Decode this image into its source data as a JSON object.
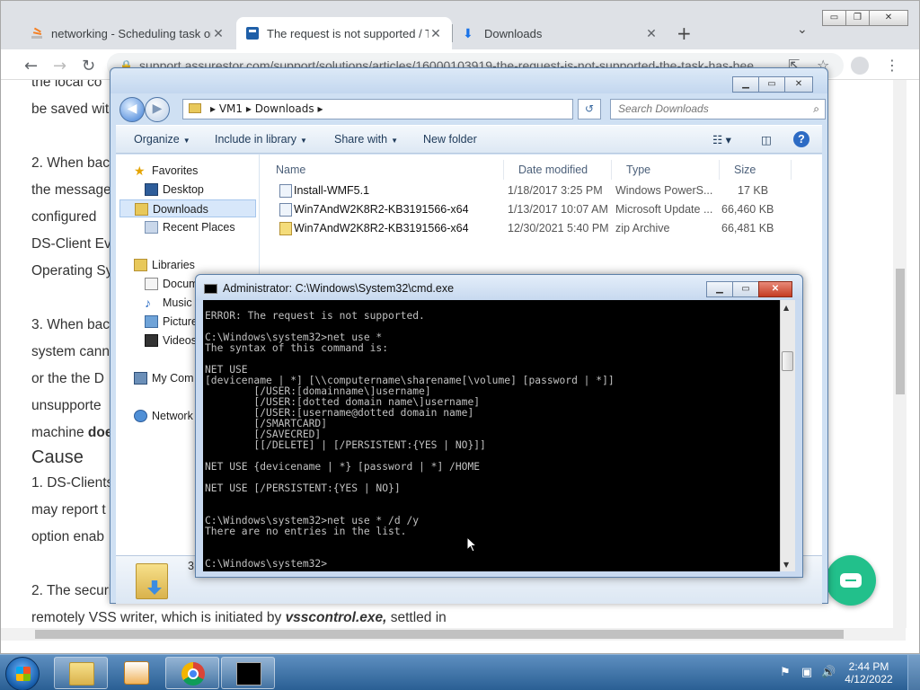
{
  "browser": {
    "tabs": [
      {
        "title": "networking - Scheduling task on",
        "close": "✕"
      },
      {
        "title": "The request is not supported / Th",
        "close": "✕"
      },
      {
        "title": "Downloads",
        "close": "✕"
      }
    ],
    "new_tab": "+",
    "tab_menu": "⌄",
    "url": "support.assurestor.com/support/solutions/articles/16000103919-the-request-is-not-supported-the-task-has-bee...",
    "back": "←",
    "forward": "→",
    "reload": "↻",
    "share_icon": "⇱",
    "star_icon": "☆",
    "menu_icon": "⋮",
    "win_min": "▭",
    "win_restore": "❐",
    "win_close": "✕"
  },
  "article": {
    "lines": [
      {
        "text": "the local co"
      },
      {
        "text": "be saved wit"
      },
      {
        "text": "2. When bac"
      },
      {
        "text": "the message"
      },
      {
        "text": "configured",
        "style": "bi"
      },
      {
        "text": "DS-Client Ev"
      },
      {
        "text": "Operating Sy"
      },
      {
        "text": "3. When bac"
      },
      {
        "text": "system cann",
        "style": "bi"
      },
      {
        "text": "or the the D"
      },
      {
        "text": "unsupporte",
        "style": "bi"
      },
      {
        "text": "machine ",
        "bold_tail": "doe"
      },
      {
        "text": "1. DS-Clients"
      },
      {
        "text": "may report t"
      },
      {
        "text": "option enab"
      },
      {
        "text": "2. The securi"
      },
      {
        "text": "remotely VSS writer, which is initiated by ",
        "bold_tail": "vsscontrol.exe,",
        "tail": " settled in"
      }
    ],
    "heading_cause": "Cause"
  },
  "explorer": {
    "win_min": "▁",
    "win_max": "▭",
    "win_close": "✕",
    "back": "◀",
    "forward": "▶",
    "breadcrumb": [
      "VM1",
      "Downloads"
    ],
    "search_placeholder": "Search Downloads",
    "search_icon": "⌕",
    "refresh": "↺",
    "commands": [
      "Organize",
      "Include in library",
      "Share with",
      "New folder"
    ],
    "help": "?",
    "nav": {
      "favorites": "Favorites",
      "desktop": "Desktop",
      "downloads": "Downloads",
      "recent": "Recent Places",
      "libraries": "Libraries",
      "documents": "Docum",
      "music": "Music",
      "pictures": "Picture",
      "videos": "Videos",
      "computer": "My Com",
      "network": "Network"
    },
    "columns": [
      "Name",
      "Date modified",
      "Type",
      "Size"
    ],
    "files": [
      {
        "name": "Install-WMF5.1",
        "date": "1/18/2017 3:25 PM",
        "type": "Windows PowerS...",
        "size": "17 KB"
      },
      {
        "name": "Win7AndW2K8R2-KB3191566-x64",
        "date": "1/13/2017 10:07 AM",
        "type": "Microsoft Update ...",
        "size": "66,460 KB"
      },
      {
        "name": "Win7AndW2K8R2-KB3191566-x64",
        "date": "12/30/2021 5:40 PM",
        "type": "zip Archive",
        "size": "66,481 KB"
      }
    ],
    "status_count": "3"
  },
  "cmd": {
    "title": "Administrator: C:\\Windows\\System32\\cmd.exe",
    "min": "▁",
    "max": "▭",
    "close": "✕",
    "lines": [
      "ERROR: The request is not supported.",
      "",
      "C:\\Windows\\system32>net use *",
      "The syntax of this command is:",
      "",
      "NET USE",
      "[devicename | *] [\\\\computername\\sharename[\\volume] [password | *]]",
      "        [/USER:[domainname\\]username]",
      "        [/USER:[dotted domain name\\]username]",
      "        [/USER:[username@dotted domain name]",
      "        [/SMARTCARD]",
      "        [/SAVECRED]",
      "        [[/DELETE] | [/PERSISTENT:{YES | NO}]]",
      "",
      "NET USE {devicename | *} [password | *] /HOME",
      "",
      "NET USE [/PERSISTENT:{YES | NO}]",
      "",
      "",
      "C:\\Windows\\system32>net use * /d /y",
      "There are no entries in the list.",
      "",
      "",
      "C:\\Windows\\system32>"
    ]
  },
  "taskbar": {
    "time": "2:44 PM",
    "date": "4/12/2022",
    "apps": [
      "explorer",
      "media-player",
      "chrome",
      "cmd"
    ]
  },
  "colors": {
    "accent": "#22c08b",
    "desktop": "#1c5a91"
  }
}
